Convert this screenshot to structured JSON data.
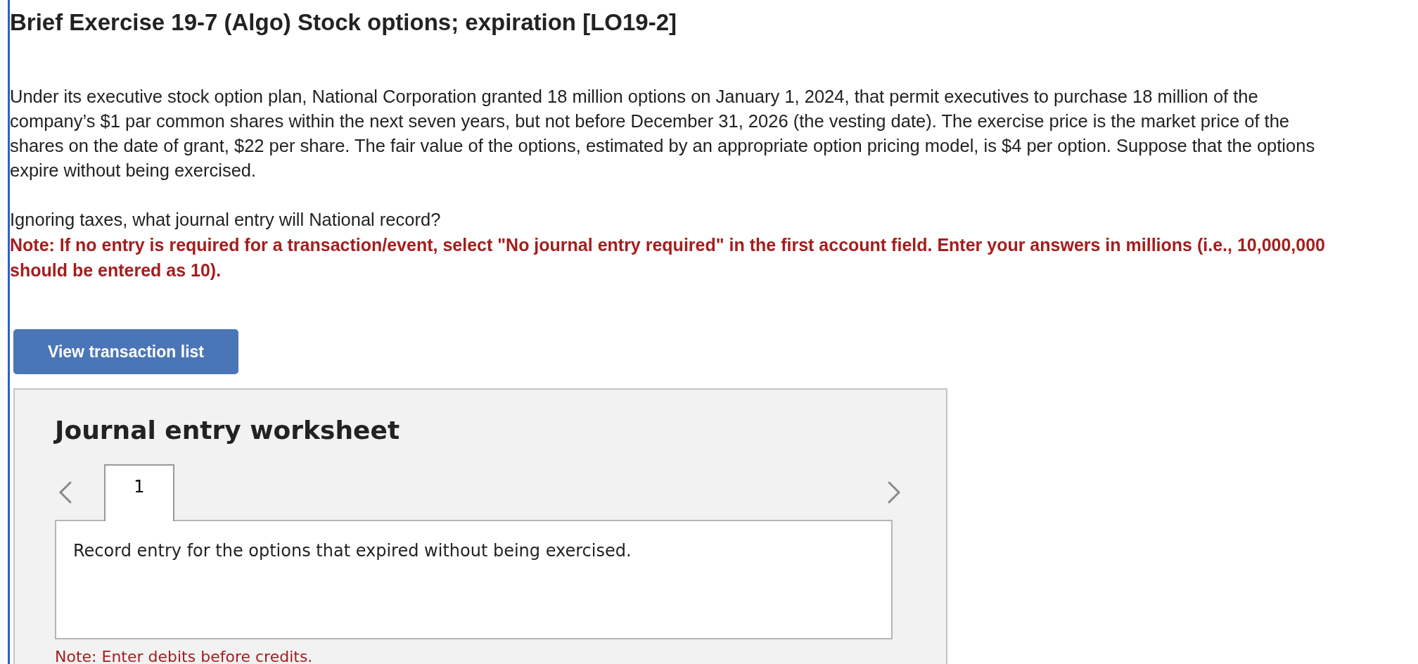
{
  "title": "Brief Exercise 19-7 (Algo) Stock options; expiration [LO19-2]",
  "problem_text": "Under its executive stock option plan, National Corporation granted 18 million options on January 1, 2024, that permit executives to purchase 18 million of the company’s $1 par common shares within the next seven years, but not before December 31, 2026 (the vesting date). The exercise price is the market price of the shares on the date of grant, $22 per share. The fair value of the options, estimated by an appropriate option pricing model, is $4 per option. Suppose that the options expire without being exercised.",
  "question": "Ignoring taxes, what journal entry will National record?",
  "instruction_note": "Note: If no entry is required for a transaction/event, select \"No journal entry required\" in the first account field. Enter your answers in millions (i.e., 10,000,000 should be entered as 10).",
  "view_button": "View transaction list",
  "worksheet": {
    "title": "Journal entry worksheet",
    "tabs": [
      {
        "label": "1",
        "selected": true
      }
    ],
    "prompt": "Record entry for the options that expired without being exercised.",
    "note": "Note: Enter debits before credits."
  }
}
